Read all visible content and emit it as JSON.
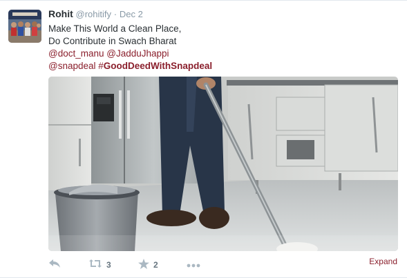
{
  "tweet": {
    "fullname": "Rohit",
    "username": "@rohitify",
    "separator": "·",
    "time": "Dec 2",
    "text_line1": "Make This World a Clean Place,",
    "text_line2": "Do Contribute in Swach Bharat",
    "mention1": "@doct_manu",
    "mention2": "@JadduJhappi",
    "mention3": "@snapdeal",
    "hashtag_symbol": "#",
    "hashtag_text": "GoodDeedWithSnapdeal"
  },
  "actions": {
    "reply_icon": "reply-icon",
    "retweet_icon": "retweet-icon",
    "retweet_count": "3",
    "favorite_icon": "star-icon",
    "favorite_count": "2",
    "more_icon": "more-dots-icon",
    "expand_label": "Expand"
  },
  "colors": {
    "link": "#8a1f2c",
    "muted": "#8899a6",
    "text": "#292f33"
  }
}
